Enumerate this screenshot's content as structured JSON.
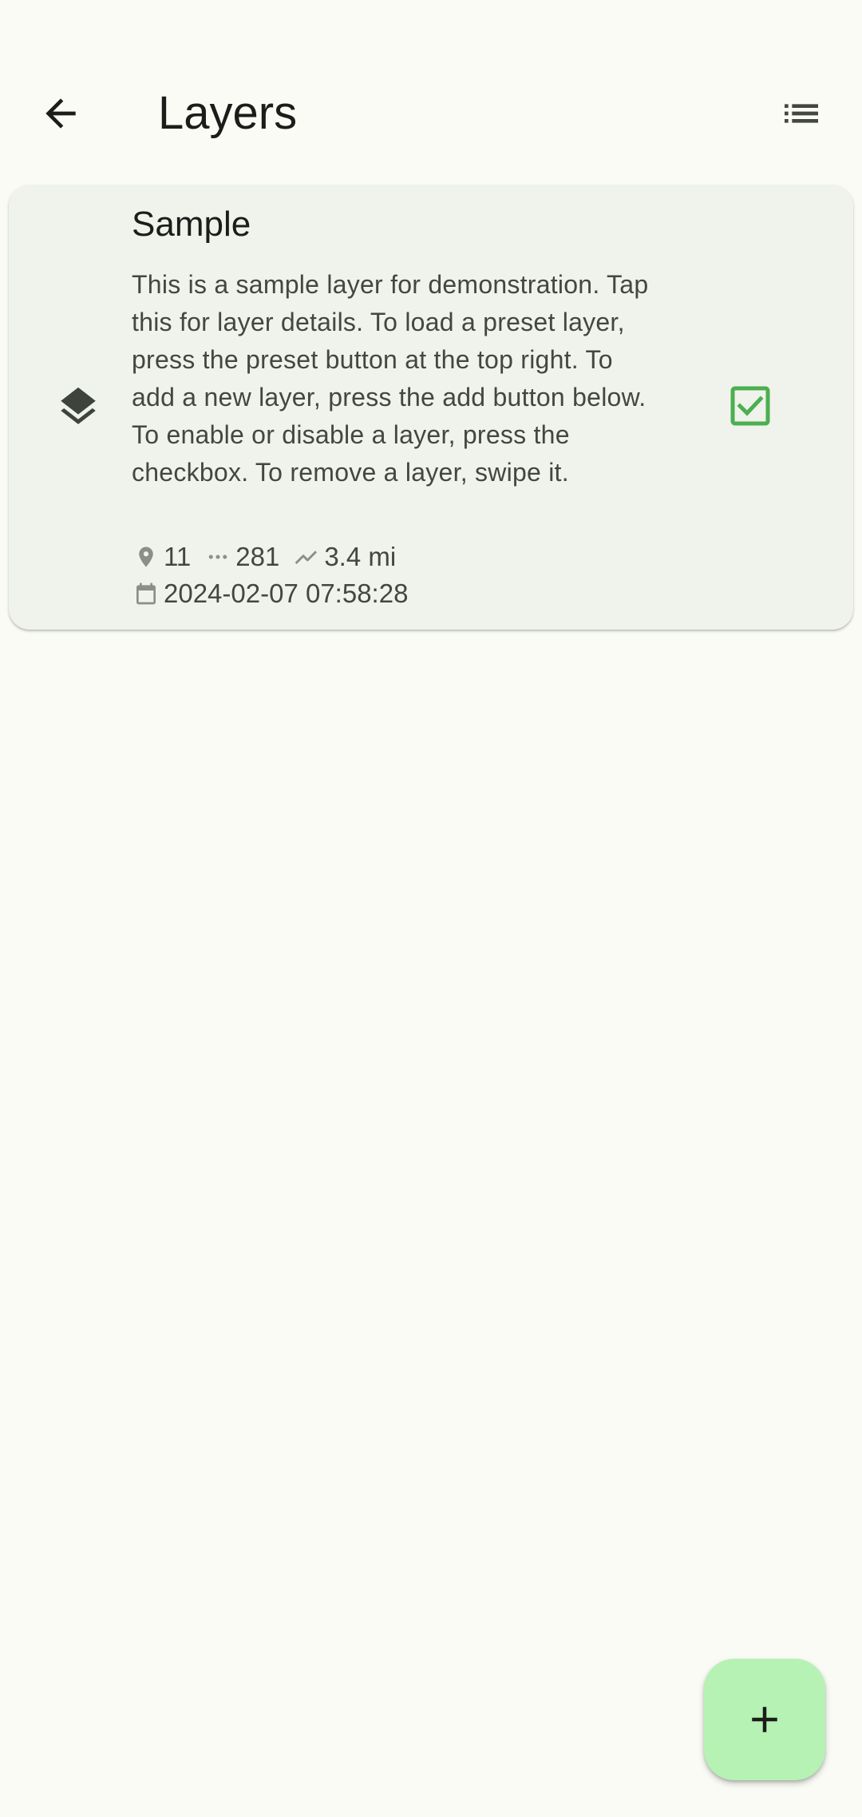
{
  "app_bar": {
    "title": "Layers",
    "back_icon": "arrow-back-icon",
    "presets_icon": "list-icon"
  },
  "layers": [
    {
      "title": "Sample",
      "description": "This is a sample layer for demonstration. Tap this for layer details. To load a preset layer, press the preset button at the top right. To add a new layer, press the add button below. To enable or disable a layer, press the checkbox. To remove a layer, swipe it.",
      "points": "11",
      "segments": "281",
      "distance": "3.4 mi",
      "date": "2024-02-07 07:58:28",
      "enabled": true,
      "icon": "layers-icon"
    }
  ],
  "fab": {
    "icon": "add-icon"
  },
  "colors": {
    "background": "#fafbf5",
    "card": "#eff3ec",
    "checkbox": "#4caf50",
    "fab": "#b5f2b3",
    "text_primary": "#1c1c1a",
    "text_secondary": "#434740"
  }
}
